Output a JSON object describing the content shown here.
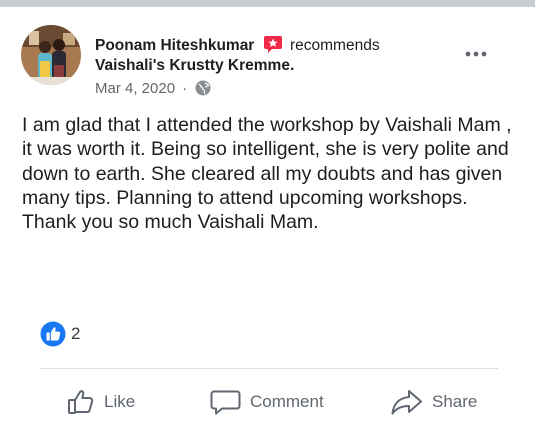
{
  "post": {
    "author": "Poonam Hiteshkumar",
    "action_text": "recommends",
    "page_name": "Vaishali's Krustty Kremme.",
    "date": "Mar 4, 2020",
    "separator": "·",
    "audience_icon": "globe-icon",
    "body_paragraphs": [
      "I am glad that I attended the workshop by Vaishali Mam , it was worth it. Being so intelligent, she is very polite and down to earth. She cleared all my doubts and has given many tips. Planning to attend upcoming workshops.",
      "Thank you so much Vaishali Mam."
    ]
  },
  "reactions": {
    "icon": "like-reaction-icon",
    "count": "2"
  },
  "actions": {
    "like_label": "Like",
    "comment_label": "Comment",
    "share_label": "Share"
  },
  "colors": {
    "reaction_blue": "#1877f2",
    "recommend_badge": "#f02849",
    "meta_gray": "#65676b",
    "action_gray": "#606770",
    "divider": "#dadde1"
  }
}
